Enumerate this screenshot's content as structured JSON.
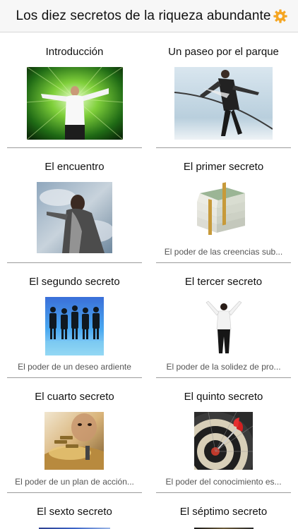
{
  "app": {
    "title": "Los diez secretos de la riqueza abundante",
    "settings_icon": "gear-icon",
    "accent": "#f5a623"
  },
  "chapters": [
    {
      "title": "Introducción",
      "subtitle": ""
    },
    {
      "title": "Un paseo por el parque",
      "subtitle": ""
    },
    {
      "title": "El encuentro",
      "subtitle": ""
    },
    {
      "title": "El primer secreto",
      "subtitle": "El poder de las creencias sub..."
    },
    {
      "title": "El segundo secreto",
      "subtitle": "El poder de un deseo ardiente"
    },
    {
      "title": "El tercer secreto",
      "subtitle": "El poder de la solidez de pro..."
    },
    {
      "title": "El cuarto secreto",
      "subtitle": "El poder de un plan de acción..."
    },
    {
      "title": "El quinto secreto",
      "subtitle": "El poder del conocimiento es..."
    },
    {
      "title": "El sexto secreto",
      "subtitle": ""
    },
    {
      "title": "El séptimo secreto",
      "subtitle": ""
    }
  ]
}
